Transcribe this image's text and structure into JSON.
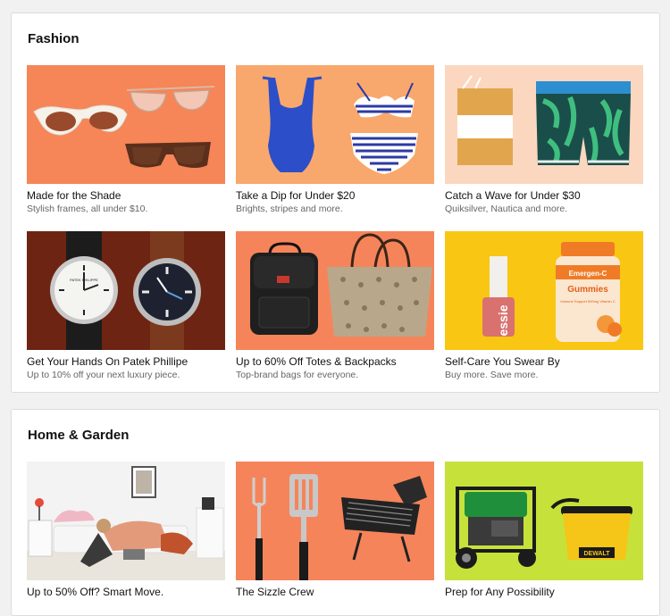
{
  "sections": [
    {
      "title": "Fashion",
      "cards": [
        {
          "title": "Made for the Shade",
          "subtitle": "Stylish frames, all under $10.",
          "bg": "#f68558",
          "image": "sunglasses-image"
        },
        {
          "title": "Take a Dip for Under $20",
          "subtitle": "Brights, stripes and more.",
          "bg": "#f8a86d",
          "image": "swimsuit-image"
        },
        {
          "title": "Catch a Wave for Under $30",
          "subtitle": "Quiksilver, Nautica and more.",
          "bg": "#fcd7c0",
          "image": "board-shorts-image"
        },
        {
          "title": "Get Your Hands On Patek Phillipe",
          "subtitle": "Up to 10% off your next luxury piece.",
          "bg": "#6e2412",
          "image": "watches-image",
          "watch_brand": "PATEK PHILIPPE"
        },
        {
          "title": "Up to 60% Off Totes & Backpacks",
          "subtitle": "Top-brand bags for everyone.",
          "bg": "#f6845a",
          "image": "bags-image"
        },
        {
          "title": "Self-Care You Swear By",
          "subtitle": "Buy more. Save more.",
          "bg": "#f9c613",
          "image": "self-care-image",
          "polish_brand": "essie",
          "vitamin_brand": "Emergen-C",
          "vitamin_label": "Gummies",
          "vitamin_sub": "Immune Support 500mg Vitamin C"
        }
      ]
    },
    {
      "title": "Home & Garden",
      "cards": [
        {
          "title": "Up to 50% Off? Smart Move.",
          "subtitle": "",
          "bg": "#f3f3f3",
          "image": "dorm-room-image"
        },
        {
          "title": "The Sizzle Crew",
          "subtitle": "",
          "bg": "#f6845a",
          "image": "grill-tools-image"
        },
        {
          "title": "Prep for Any Possibility",
          "subtitle": "",
          "bg": "#c6e23a",
          "image": "generator-image",
          "vac_brand": "DEWALT"
        }
      ]
    }
  ]
}
